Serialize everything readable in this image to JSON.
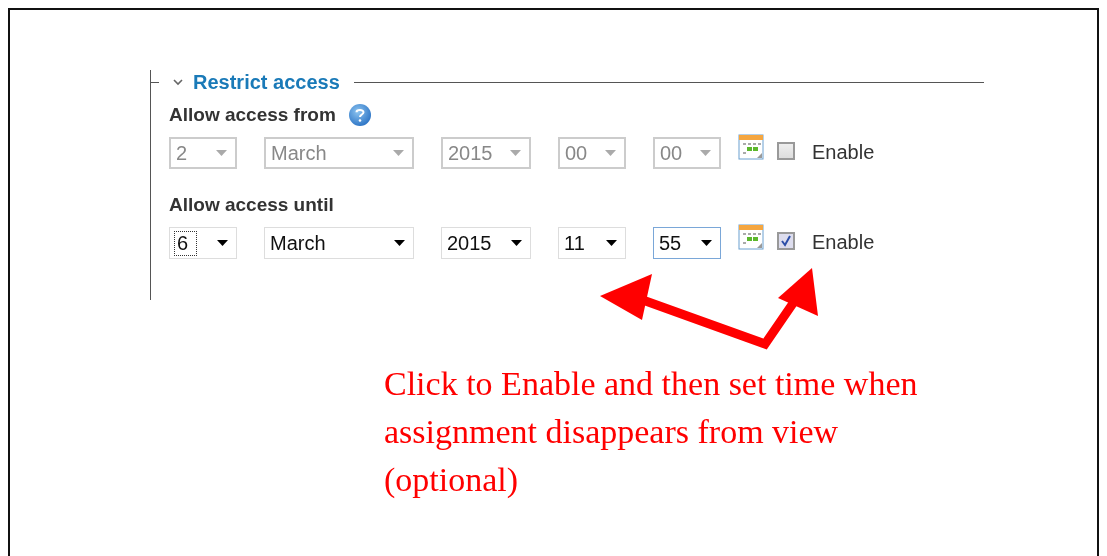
{
  "section": {
    "title": "Restrict access",
    "expanded": true
  },
  "rows": [
    {
      "label": "Allow access from",
      "help": true,
      "enabled": false,
      "fields": [
        {
          "value": "2",
          "focused": false
        },
        {
          "value": "March",
          "focused": false
        },
        {
          "value": "2015",
          "focused": false
        },
        {
          "value": "00",
          "focused": false
        },
        {
          "value": "00",
          "focused": false
        }
      ],
      "checkbox": {
        "label": "Enable",
        "checked": false
      }
    },
    {
      "label": "Allow access until",
      "help": false,
      "enabled": true,
      "fields": [
        {
          "value": "6",
          "focused": false,
          "dotted": true
        },
        {
          "value": "March",
          "focused": false
        },
        {
          "value": "2015",
          "focused": false
        },
        {
          "value": "11",
          "focused": false
        },
        {
          "value": "55",
          "focused": true
        }
      ],
      "checkbox": {
        "label": "Enable",
        "checked": true
      }
    }
  ],
  "annotation": {
    "text": "Click to Enable and then set time when assignment disappears from view (optional)"
  }
}
